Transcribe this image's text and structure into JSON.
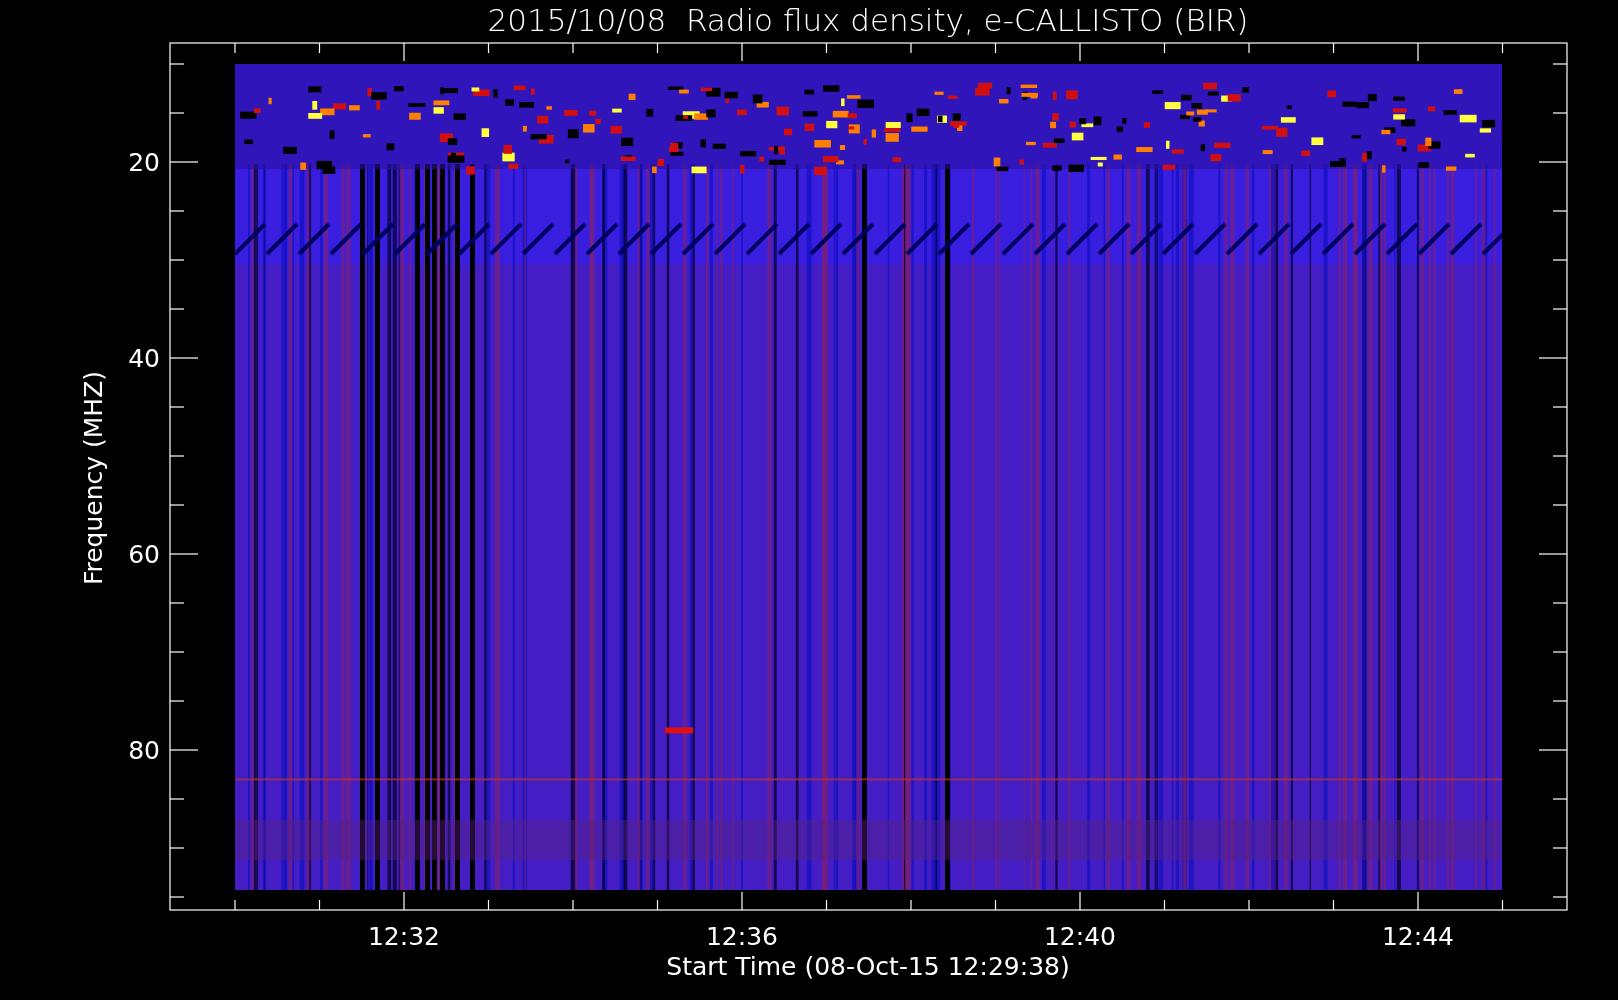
{
  "title": "2015/10/08  Radio flux density, e-CALLISTO (BIR)",
  "y_axis": {
    "label": "Frequency (MHZ)",
    "ticks": [
      "20",
      "40",
      "60",
      "80"
    ]
  },
  "x_axis": {
    "label": "Start Time (08-Oct-15 12:29:38)",
    "ticks": [
      "12:32",
      "12:36",
      "12:40",
      "12:44"
    ]
  },
  "plot": {
    "kind": "spectrogram"
  }
}
